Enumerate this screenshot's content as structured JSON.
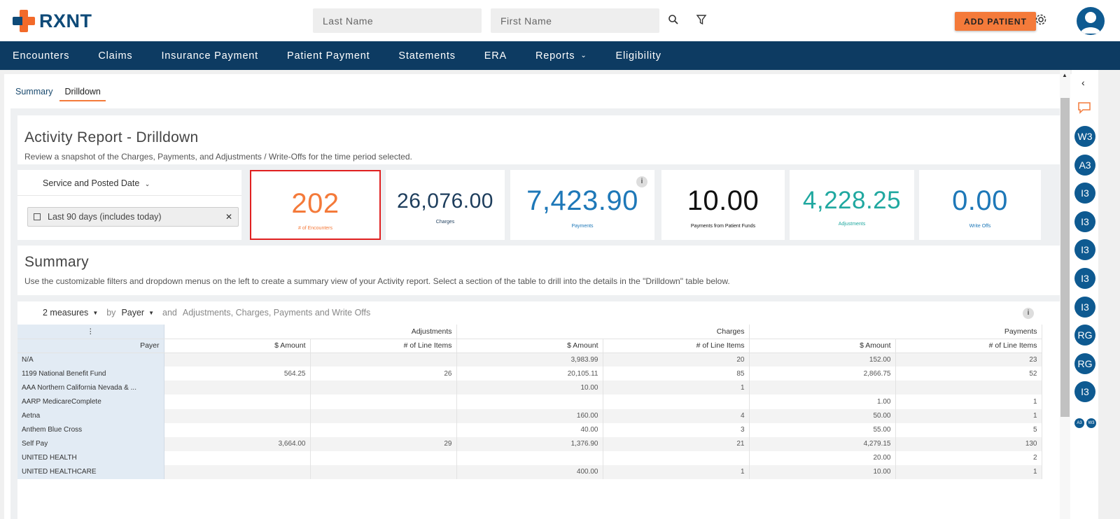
{
  "brand": {
    "name": "RXNT"
  },
  "search": {
    "last_name_placeholder": "Last Name",
    "first_name_placeholder": "First Name"
  },
  "topbar": {
    "add_patient_label": "ADD PATIENT"
  },
  "nav": {
    "items": [
      "Encounters",
      "Claims",
      "Insurance Payment",
      "Patient Payment",
      "Statements",
      "ERA",
      "Reports",
      "Eligibility"
    ]
  },
  "tabs": {
    "summary": "Summary",
    "drilldown": "Drilldown"
  },
  "header": {
    "title": "Activity Report - Drilldown",
    "description": "Review a snapshot of the Charges, Payments, and Adjustments / Write-Offs for the time period selected."
  },
  "filter": {
    "label": "Service and Posted Date",
    "chip": "Last 90 days (includes today)"
  },
  "metrics": [
    {
      "value": "202",
      "label": "# of Encounters",
      "color": "#f47a3a"
    },
    {
      "value": "26,076.00",
      "label": "Charges",
      "color": "#1d3d5c"
    },
    {
      "value": "7,423.90",
      "label": "Payments",
      "color": "#1e78b8"
    },
    {
      "value": "10.00",
      "label": "Payments from Patient Funds",
      "color": "#111111"
    },
    {
      "value": "4,228.25",
      "label": "Adjustments",
      "color": "#20a8a0"
    },
    {
      "value": "0.00",
      "label": "Write Offs",
      "color": "#1e78b8"
    }
  ],
  "summary": {
    "title": "Summary",
    "description": "Use the customizable filters and dropdown menus on the left to create a summary view of your Activity report. Select a section of the table to drill into the details in the \"Drilldown\" table below."
  },
  "pivot": {
    "measures": "2 measures",
    "by": "by",
    "dimension": "Payer",
    "and": "and",
    "columns": "Adjustments, Charges, Payments and Write Offs",
    "row_header": "Payer",
    "groups": [
      "Adjustments",
      "Charges",
      "Payments"
    ],
    "subheaders": [
      "$ Amount",
      "# of Line Items",
      "$ Amount",
      "# of Line Items",
      "$ Amount",
      "# of Line Items"
    ],
    "rows": [
      [
        "N/A",
        "",
        "",
        "3,983.99",
        "20",
        "152.00",
        "23"
      ],
      [
        "1199 National Benefit Fund",
        "564.25",
        "26",
        "20,105.11",
        "85",
        "2,866.75",
        "52"
      ],
      [
        "AAA Northern California Nevada & ...",
        "",
        "",
        "10.00",
        "1",
        "",
        ""
      ],
      [
        "AARP MedicareComplete",
        "",
        "",
        "",
        "",
        "1.00",
        "1"
      ],
      [
        "Aetna",
        "",
        "",
        "160.00",
        "4",
        "50.00",
        "1"
      ],
      [
        "Anthem Blue Cross",
        "",
        "",
        "40.00",
        "3",
        "55.00",
        "5"
      ],
      [
        "Self Pay",
        "3,664.00",
        "29",
        "1,376.90",
        "21",
        "4,279.15",
        "130"
      ],
      [
        "UNITED HEALTH",
        "",
        "",
        "",
        "",
        "20.00",
        "2"
      ],
      [
        "UNITED HEALTHCARE",
        "",
        "",
        "400.00",
        "1",
        "10.00",
        "1"
      ]
    ]
  },
  "rail": {
    "buttons": [
      "W3",
      "A3",
      "I3",
      "I3",
      "I3",
      "I3",
      "I3",
      "RG",
      "RG",
      "I3"
    ],
    "mini": [
      "A3",
      "W3"
    ]
  }
}
